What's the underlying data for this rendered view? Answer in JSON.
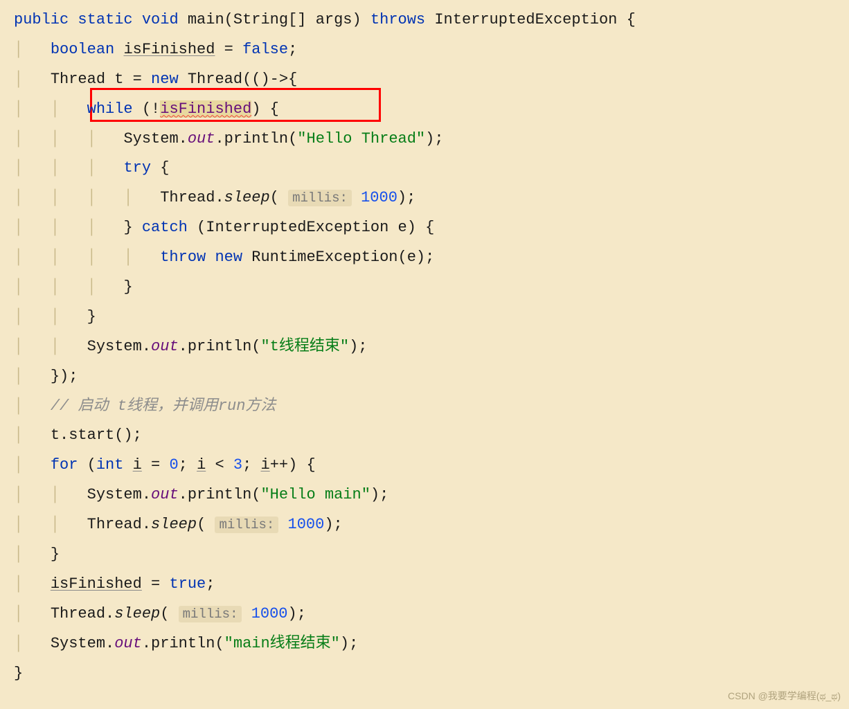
{
  "code": {
    "line1": {
      "kw_public": "public",
      "kw_static": "static",
      "kw_void": "void",
      "method_main": "main",
      "type_string": "String",
      "var_args": "args",
      "kw_throws": "throws",
      "exc": "InterruptedException"
    },
    "line2": {
      "kw_boolean": "boolean",
      "var_isFinished": "isFinished",
      "kw_false": "false"
    },
    "line3": {
      "type_thread": "Thread",
      "var_t": "t",
      "kw_new": "new",
      "type_thread2": "Thread"
    },
    "line4": {
      "kw_while": "while",
      "var_isFinished": "isFinished"
    },
    "line5": {
      "cls_system": "System",
      "field_out": "out",
      "method_println": "println",
      "str": "\"Hello Thread\""
    },
    "line6": {
      "kw_try": "try"
    },
    "line7": {
      "cls_thread": "Thread",
      "method_sleep": "sleep",
      "hint_millis": "millis:",
      "num": "1000"
    },
    "line8": {
      "kw_catch": "catch",
      "type_exc": "InterruptedException",
      "var_e": "e"
    },
    "line9": {
      "kw_throw": "throw",
      "kw_new": "new",
      "type_rte": "RuntimeException",
      "var_e": "e"
    },
    "line12": {
      "cls_system": "System",
      "field_out": "out",
      "method_println": "println",
      "str": "\"t线程结束\""
    },
    "line14": {
      "comment": "// 启动 t线程，并调用run方法"
    },
    "line15": {
      "var_t": "t",
      "method_start": "start"
    },
    "line16": {
      "kw_for": "for",
      "kw_int": "int",
      "var_i": "i",
      "num_0": "0",
      "var_i2": "i",
      "num_3": "3",
      "var_i3": "i"
    },
    "line17": {
      "cls_system": "System",
      "field_out": "out",
      "method_println": "println",
      "str": "\"Hello main\""
    },
    "line18": {
      "cls_thread": "Thread",
      "method_sleep": "sleep",
      "hint_millis": "millis:",
      "num": "1000"
    },
    "line20": {
      "var_isFinished": "isFinished",
      "kw_true": "true"
    },
    "line21": {
      "cls_thread": "Thread",
      "method_sleep": "sleep",
      "hint_millis": "millis:",
      "num": "1000"
    },
    "line22": {
      "cls_system": "System",
      "field_out": "out",
      "method_println": "println",
      "str": "\"main线程结束\""
    }
  },
  "watermark": "CSDN @我要学编程(ಥ_ಥ)"
}
